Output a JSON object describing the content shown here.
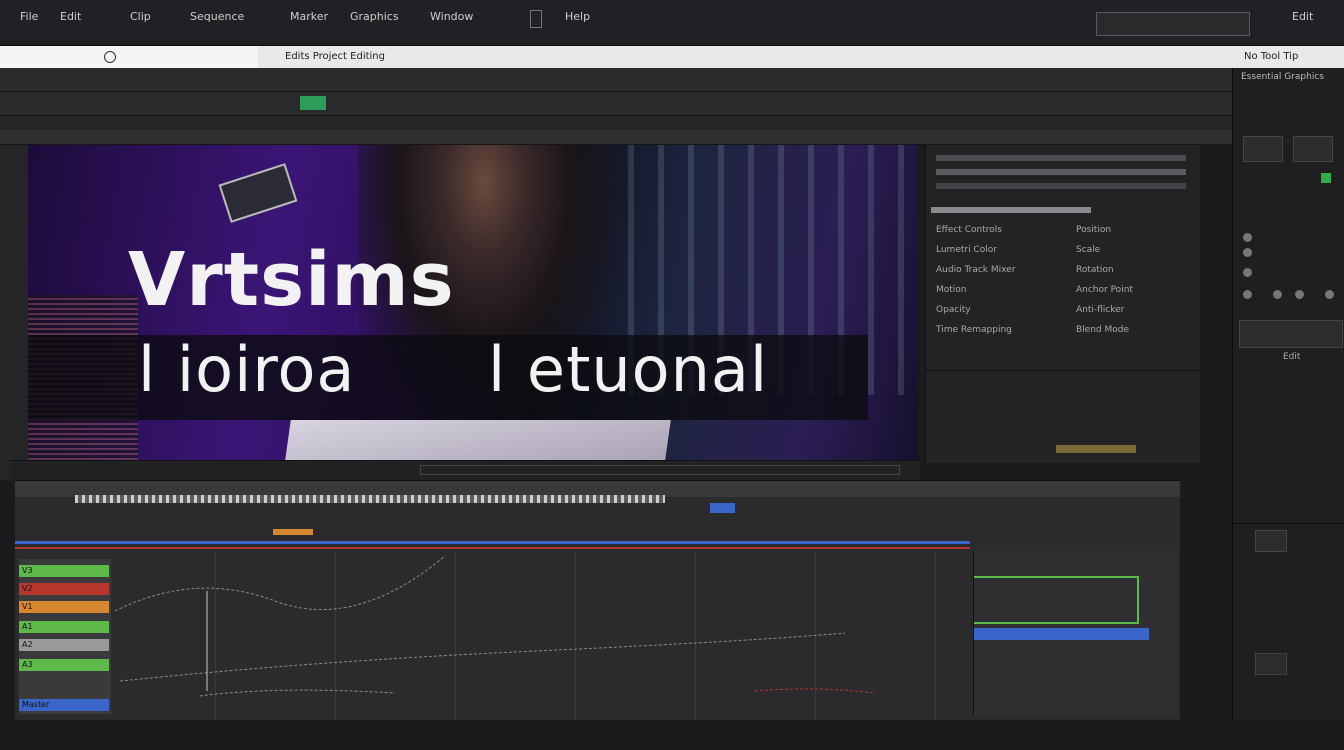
{
  "menubar": {
    "items": [
      "File",
      "Edit",
      "Clip",
      "Sequence",
      "Marker",
      "Graphics",
      "Window",
      "Help"
    ],
    "right_label": "Edit"
  },
  "title_strip": {
    "path_label": "Edits Project Editing",
    "right_label": "No Tool Tip"
  },
  "viewer": {
    "title_line1": "Vrtsims",
    "title_line2_left": "l ioiroa",
    "title_line2_right": "l etuonal"
  },
  "inspector": {
    "rows_left": [
      "Effect Controls",
      "Lumetri Color",
      "Audio Track Mixer",
      "Motion",
      "Opacity",
      "Time Remapping"
    ],
    "rows_right": [
      "Position",
      "Scale",
      "Rotation",
      "Anchor Point",
      "Anti-flicker",
      "Blend Mode"
    ]
  },
  "timeline": {
    "tracks": [
      "V3",
      "V2",
      "V1",
      "A1",
      "A2",
      "A3",
      "Master"
    ],
    "colors": {
      "green": "#5fb84a",
      "orange": "#d7882f",
      "blue": "#3b66c9",
      "red": "#b8372d",
      "purple": "#6a41a8"
    }
  },
  "farright": {
    "header": "Essential Graphics",
    "sub": "Edit"
  }
}
